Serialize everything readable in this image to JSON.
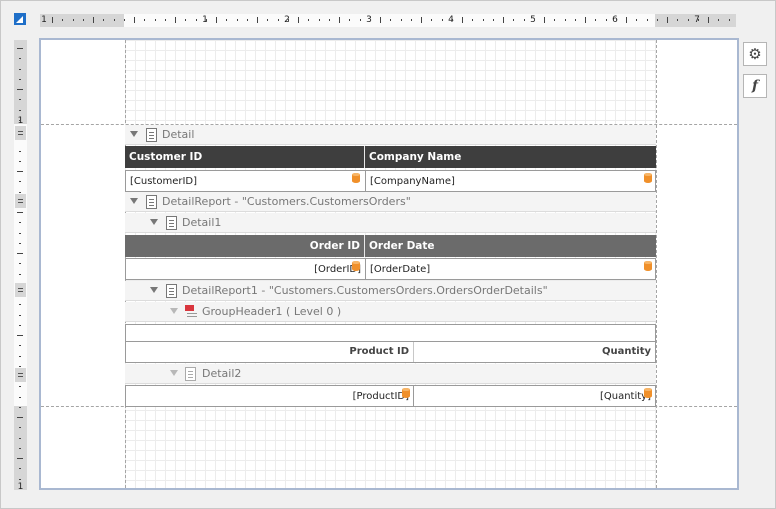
{
  "toolbar": {
    "properties_icon": "gear-icon",
    "expressions_icon": "function-icon",
    "expressions_glyph": "f"
  },
  "ruler": {
    "horizontal_numbers": [
      "1",
      "1",
      "2",
      "3",
      "4",
      "5",
      "6",
      "7"
    ],
    "vertical_numbers": [
      "1",
      "1"
    ]
  },
  "bands": {
    "detail": "Detail",
    "detail_report": "DetailReport - \"Customers.CustomersOrders\"",
    "detail1": "Detail1",
    "detail_report1": "DetailReport1 - \"Customers.CustomersOrders.OrdersOrderDetails\"",
    "group_header1": "GroupHeader1 ( Level 0 )",
    "detail2": "Detail2"
  },
  "customers_table": {
    "headers": [
      "Customer ID",
      "Company Name"
    ],
    "cells": [
      "[CustomerID]",
      "[CompanyName]"
    ]
  },
  "orders_table": {
    "headers": [
      "Order ID",
      "Order Date"
    ],
    "cells": [
      "[OrderID]",
      "[OrderDate]"
    ]
  },
  "details_table": {
    "headers": [
      "Product ID",
      "Quantity"
    ],
    "cells": [
      "[ProductID]",
      "[Quantity]"
    ]
  },
  "colors": {
    "header_dark": "#3e3e3e",
    "header_mid": "#6b6b6b",
    "accent": "#1f6fc8",
    "binding_icon": "#f0902a",
    "group_icon": "#d9363e"
  }
}
